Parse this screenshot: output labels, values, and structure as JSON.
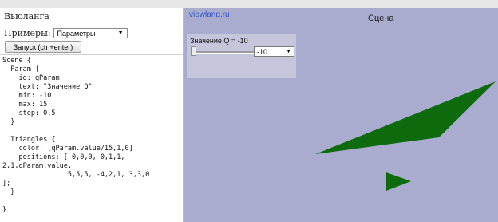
{
  "app": {
    "title": "Вьюланга"
  },
  "examples": {
    "label": "Примеры:",
    "selected": "Параметры"
  },
  "run_button": {
    "label": "Запуск (ctrl+enter)"
  },
  "code": "Scene {\n  Param {\n    id: qParam\n    text: \"Значение Q\"\n    min: -10\n    max: 15\n    step: 0.5\n  }\n\n  Triangles {\n    color: [qParam.value/15,1,0]\n    positions: [ 0,0,0, 0,1,1,\n2,1,qParam.value,\n                5,5,5, -4,2,1, 3,3,0\n];\n  }\n\n}",
  "scene": {
    "link": "viewlang.ru",
    "title": "Сцена",
    "background": "#a9abcf",
    "triangle_color": "#0d6b0d"
  },
  "param": {
    "label": "Значение Q = -10",
    "value": "-10",
    "min": -10,
    "max": 15,
    "slider_fraction": 0
  }
}
